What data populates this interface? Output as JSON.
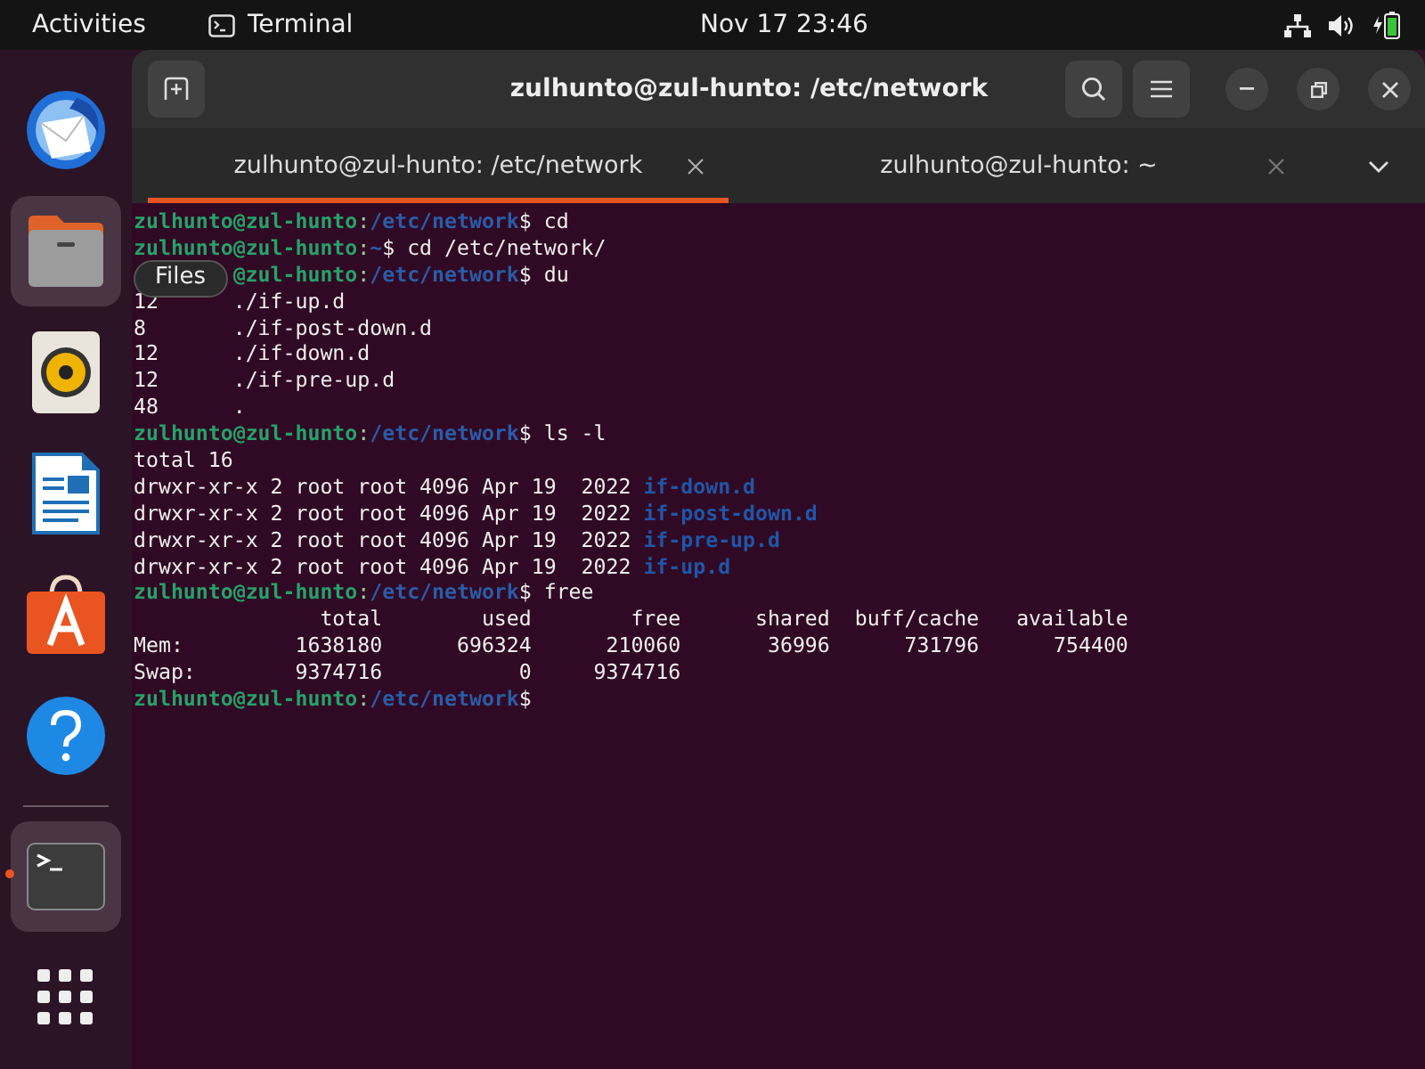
{
  "top_bar": {
    "activities": "Activities",
    "app_name": "Terminal",
    "clock": "Nov 17  23:46"
  },
  "dock": {
    "items": [
      {
        "kind": "mail",
        "highlighted": false,
        "running": false
      },
      {
        "kind": "files",
        "highlighted": true,
        "running": false
      },
      {
        "kind": "music",
        "highlighted": false,
        "running": false
      },
      {
        "kind": "writer",
        "highlighted": false,
        "running": false
      },
      {
        "kind": "store",
        "highlighted": false,
        "running": false
      },
      {
        "kind": "help",
        "highlighted": false,
        "running": false
      },
      {
        "kind": "terminal",
        "highlighted": true,
        "running": true
      },
      {
        "kind": "apps",
        "highlighted": false,
        "running": false
      }
    ],
    "tooltip": "Files"
  },
  "window": {
    "title": "zulhunto@zul-hunto: /etc/network",
    "tabs": [
      {
        "label": "zulhunto@zul-hunto: /etc/network",
        "selected": true
      },
      {
        "label": "zulhunto@zul-hunto: ~",
        "selected": false
      }
    ],
    "lines": [
      {
        "covered": false,
        "segments": [
          {
            "kind": "user",
            "text": "zulhunto@zul-hunto"
          },
          {
            "kind": "sep",
            "text": ":"
          },
          {
            "kind": "path",
            "text": "/etc/network"
          },
          {
            "kind": "text",
            "text": "$ cd"
          }
        ]
      },
      {
        "covered": false,
        "segments": [
          {
            "kind": "user",
            "text": "zulhunto@zul-hunto"
          },
          {
            "kind": "sep",
            "text": ":"
          },
          {
            "kind": "path",
            "text": "~"
          },
          {
            "kind": "text",
            "text": "$ cd /etc/network/"
          }
        ]
      },
      {
        "covered": true,
        "segments": [
          {
            "kind": "user",
            "text": "@zul-hunto"
          },
          {
            "kind": "sep",
            "text": ":"
          },
          {
            "kind": "path",
            "text": "/etc/network"
          },
          {
            "kind": "text",
            "text": "$ du"
          }
        ]
      },
      {
        "covered": false,
        "segments": [
          {
            "kind": "text",
            "text": "12      ./if-up.d"
          }
        ]
      },
      {
        "covered": false,
        "segments": [
          {
            "kind": "text",
            "text": "8       ./if-post-down.d"
          }
        ]
      },
      {
        "covered": false,
        "segments": [
          {
            "kind": "text",
            "text": "12      ./if-down.d"
          }
        ]
      },
      {
        "covered": false,
        "segments": [
          {
            "kind": "text",
            "text": "12      ./if-pre-up.d"
          }
        ]
      },
      {
        "covered": false,
        "segments": [
          {
            "kind": "text",
            "text": "48      ."
          }
        ]
      },
      {
        "covered": false,
        "segments": [
          {
            "kind": "user",
            "text": "zulhunto@zul-hunto"
          },
          {
            "kind": "sep",
            "text": ":"
          },
          {
            "kind": "path",
            "text": "/etc/network"
          },
          {
            "kind": "text",
            "text": "$ ls -l"
          }
        ]
      },
      {
        "covered": false,
        "segments": [
          {
            "kind": "text",
            "text": "total 16"
          }
        ]
      },
      {
        "covered": false,
        "segments": [
          {
            "kind": "text",
            "text": "drwxr-xr-x 2 root root 4096 Apr 19  2022 "
          },
          {
            "kind": "dir",
            "text": "if-down.d"
          }
        ]
      },
      {
        "covered": false,
        "segments": [
          {
            "kind": "text",
            "text": "drwxr-xr-x 2 root root 4096 Apr 19  2022 "
          },
          {
            "kind": "dir",
            "text": "if-post-down.d"
          }
        ]
      },
      {
        "covered": false,
        "segments": [
          {
            "kind": "text",
            "text": "drwxr-xr-x 2 root root 4096 Apr 19  2022 "
          },
          {
            "kind": "dir",
            "text": "if-pre-up.d"
          }
        ]
      },
      {
        "covered": false,
        "segments": [
          {
            "kind": "text",
            "text": "drwxr-xr-x 2 root root 4096 Apr 19  2022 "
          },
          {
            "kind": "dir",
            "text": "if-up.d"
          }
        ]
      },
      {
        "covered": false,
        "segments": [
          {
            "kind": "user",
            "text": "zulhunto@zul-hunto"
          },
          {
            "kind": "sep",
            "text": ":"
          },
          {
            "kind": "path",
            "text": "/etc/network"
          },
          {
            "kind": "text",
            "text": "$ free"
          }
        ]
      },
      {
        "covered": false,
        "segments": [
          {
            "kind": "text",
            "text": "               total        used        free      shared  buff/cache   available"
          }
        ]
      },
      {
        "covered": false,
        "segments": [
          {
            "kind": "text",
            "text": "Mem:         1638180      696324      210060       36996      731796      754400"
          }
        ]
      },
      {
        "covered": false,
        "segments": [
          {
            "kind": "text",
            "text": "Swap:        9374716           0     9374716"
          }
        ]
      },
      {
        "covered": false,
        "segments": [
          {
            "kind": "user",
            "text": "zulhunto@zul-hunto"
          },
          {
            "kind": "sep",
            "text": ":"
          },
          {
            "kind": "path",
            "text": "/etc/network"
          },
          {
            "kind": "text",
            "text": "$"
          }
        ]
      }
    ]
  }
}
